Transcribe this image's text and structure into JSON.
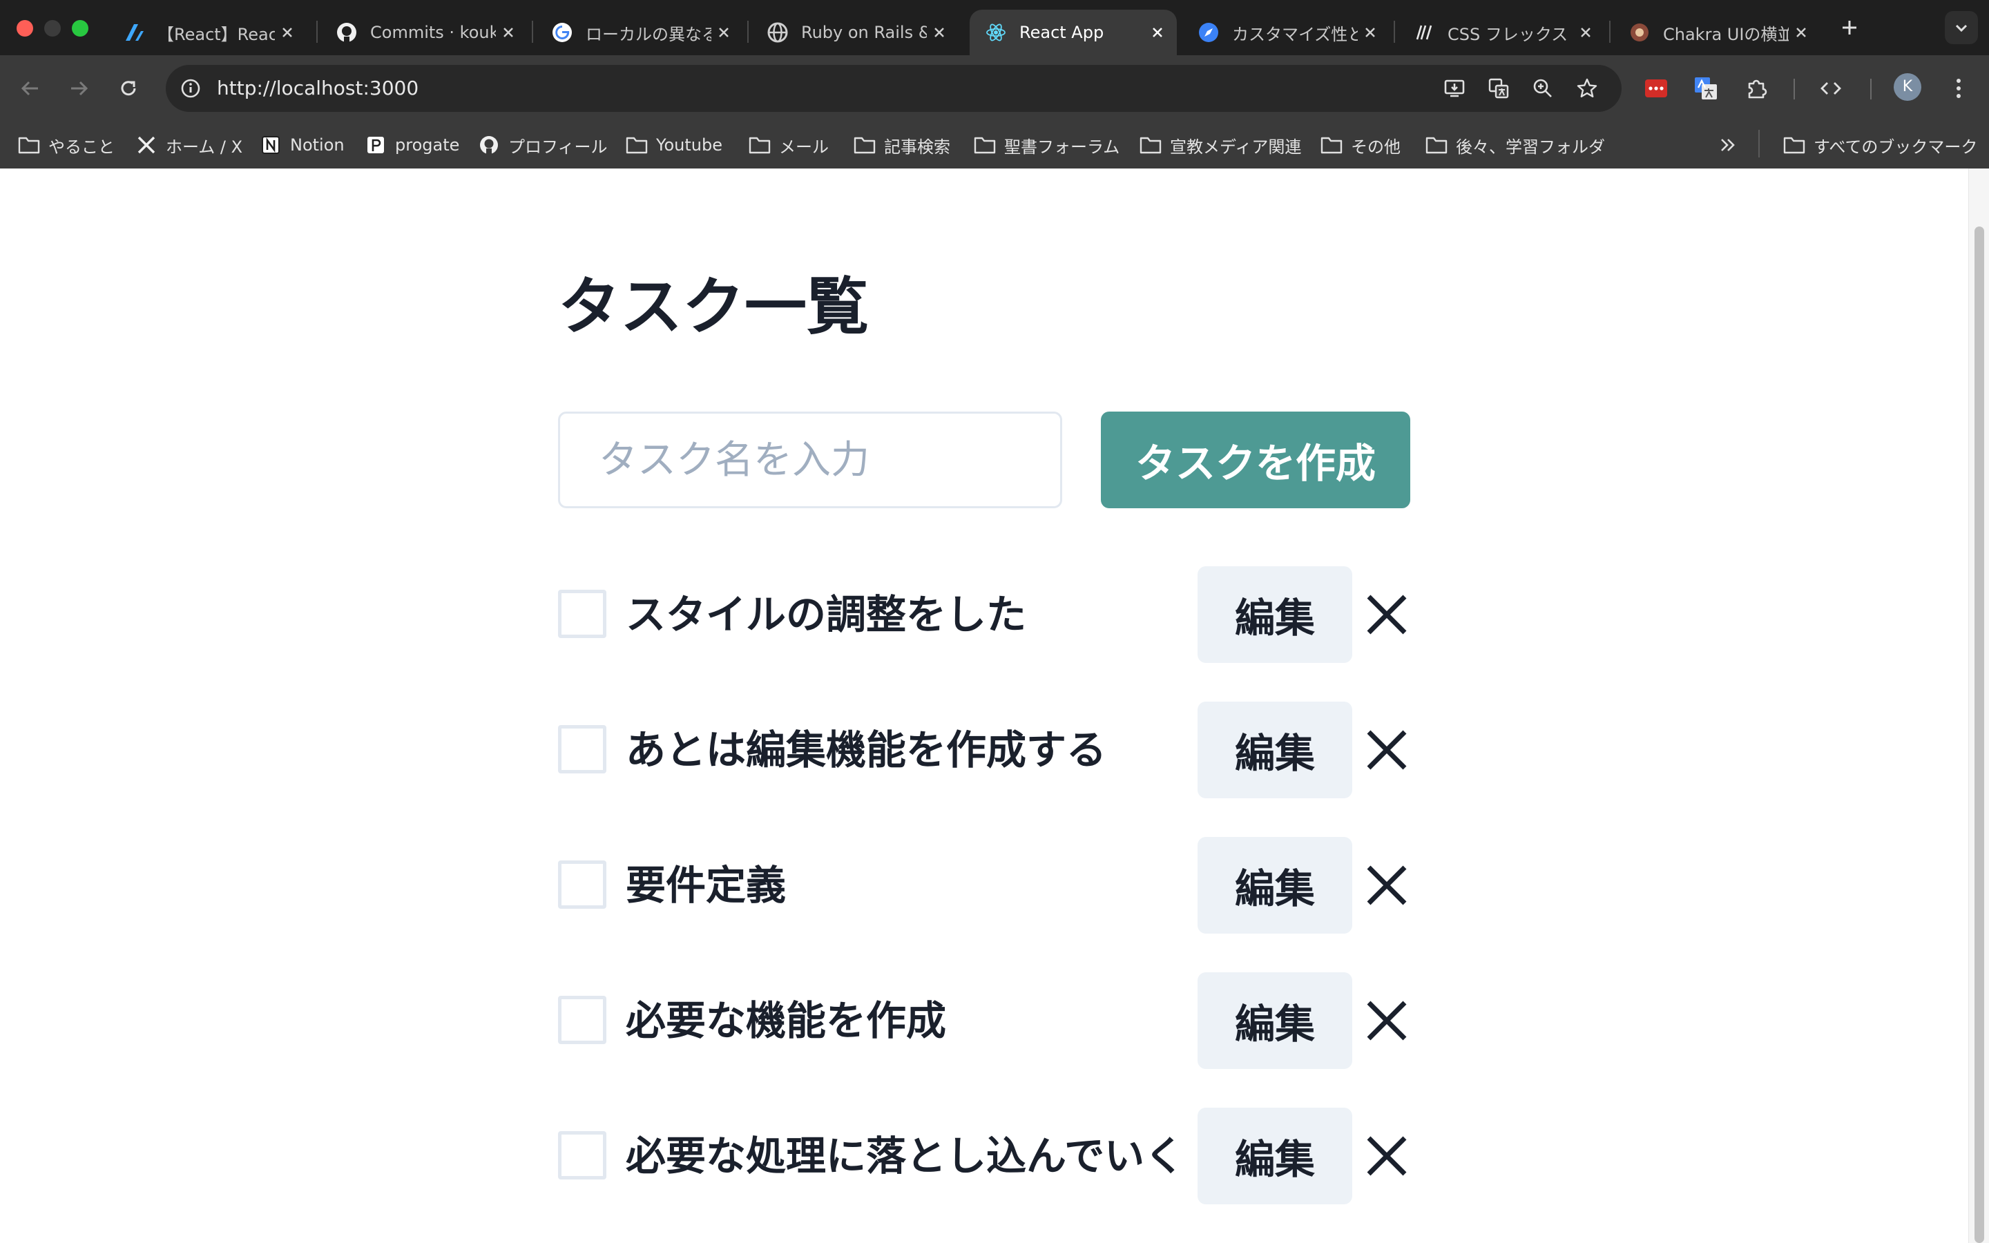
{
  "browser": {
    "tabs": [
      {
        "title": "【React】React",
        "icon": "zenn-icon",
        "active": false
      },
      {
        "title": "Commits · kouk",
        "icon": "github-icon",
        "active": false
      },
      {
        "title": "ローカルの異なる",
        "icon": "google-icon",
        "active": false
      },
      {
        "title": "Ruby on Rails &",
        "icon": "globe-icon",
        "active": false
      },
      {
        "title": "React App",
        "icon": "react-icon",
        "active": true
      },
      {
        "title": "カスタマイズ性と",
        "icon": "compass-icon",
        "active": false
      },
      {
        "title": "CSS フレックス",
        "icon": "mdn-icon",
        "active": false
      },
      {
        "title": "Chakra UIの横並",
        "icon": "qiita-icon",
        "active": false
      }
    ],
    "url": "http://localhost:3000",
    "profile_initial": "K",
    "bookmarks": [
      {
        "label": "やること",
        "icon": "folder-icon"
      },
      {
        "label": "ホーム / X",
        "icon": "x-icon"
      },
      {
        "label": "Notion",
        "icon": "notion-icon"
      },
      {
        "label": "progate",
        "icon": "progate-icon"
      },
      {
        "label": "プロフィール",
        "icon": "github-icon"
      },
      {
        "label": "Youtube",
        "icon": "folder-icon"
      },
      {
        "label": "メール",
        "icon": "folder-icon"
      },
      {
        "label": "記事検索",
        "icon": "folder-icon"
      },
      {
        "label": "聖書フォーラム",
        "icon": "folder-icon"
      },
      {
        "label": "宣教メディア関連",
        "icon": "folder-icon"
      },
      {
        "label": "その他",
        "icon": "folder-icon"
      },
      {
        "label": "後々、学習フォルダ",
        "icon": "folder-icon"
      }
    ],
    "all_bookmarks_label": "すべてのブックマーク"
  },
  "page": {
    "title": "タスク一覧",
    "input_placeholder": "タスク名を入力",
    "input_value": "",
    "create_button": "タスクを作成",
    "edit_label": "編集",
    "tasks": [
      {
        "name": "スタイルの調整をした",
        "done": false
      },
      {
        "name": "あとは編集機能を作成する",
        "done": false
      },
      {
        "name": "要件定義",
        "done": false
      },
      {
        "name": "必要な機能を作成",
        "done": false
      },
      {
        "name": "必要な処理に落とし込んでいく",
        "done": false
      }
    ]
  },
  "colors": {
    "accent": "#4e9a94",
    "text": "#1a202c",
    "edit_bg": "#edf2f7",
    "border": "#e2e8f0",
    "placeholder": "#a0aec0"
  }
}
